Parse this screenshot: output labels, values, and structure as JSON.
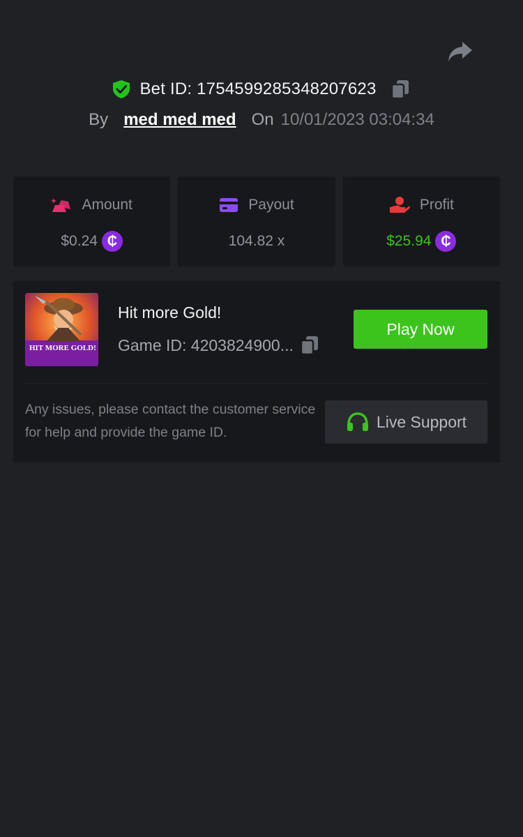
{
  "header": {
    "share_icon": "share-arrow-icon",
    "verified_icon": "shield-check-icon",
    "bet_id_text": "Bet ID: 1754599285348207623",
    "copy_icon": "copy-icon",
    "by_label": "By",
    "username": "med med med",
    "on_label": "On",
    "datetime": "10/01/2023 03:04:34"
  },
  "stats": [
    {
      "label": "Amount",
      "value": "$0.24",
      "icon": "gold-bars-icon",
      "icon_color": "#e8306f",
      "has_coin": true
    },
    {
      "label": "Payout",
      "value": "104.82 x",
      "icon": "credit-card-icon",
      "icon_color": "#8a4cf0",
      "has_coin": false
    },
    {
      "label": "Profit",
      "value": "$25.94",
      "icon": "hand-coin-icon",
      "icon_color": "#e83a3a",
      "has_coin": true
    }
  ],
  "coin_symbol": "₵",
  "game": {
    "title": "Hit more Gold!",
    "thumbnail_text": "HIT MORE GOLD!",
    "game_id_text": "Game ID: 4203824900...",
    "play_label": "Play Now",
    "help_text": "Any issues, please contact the customer service for help and provide the game ID.",
    "support_label": "Live Support",
    "support_icon": "headset-icon"
  },
  "colors": {
    "background": "#202125",
    "card": "#17181b",
    "accent_green": "#3cc31c",
    "coin_purple": "#8a2be2"
  }
}
